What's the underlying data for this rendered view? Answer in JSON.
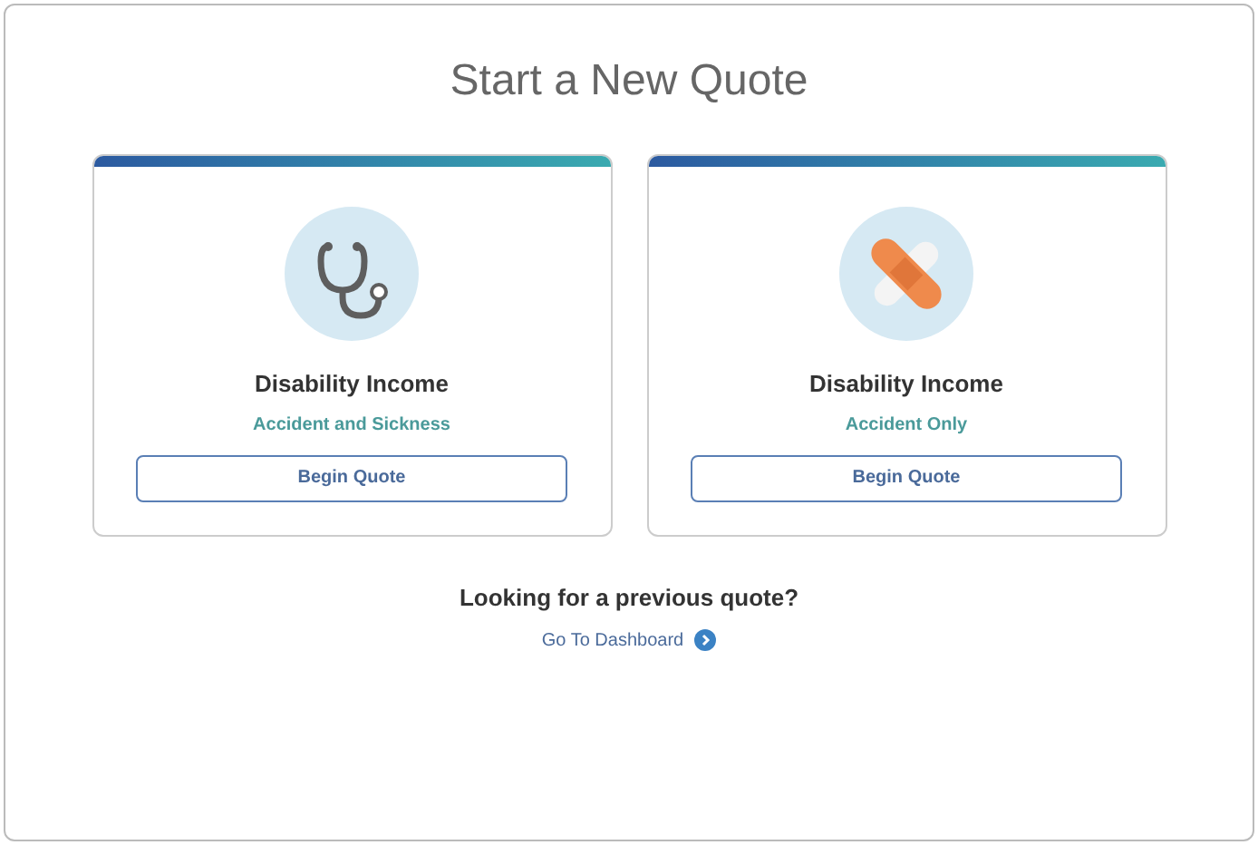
{
  "title": "Start a New Quote",
  "cards": [
    {
      "kind": "stethoscope",
      "title": "Disability Income",
      "subtitle": "Accident and Sickness",
      "button": "Begin Quote"
    },
    {
      "kind": "bandage",
      "title": "Disability Income",
      "subtitle": "Accident Only",
      "button": "Begin Quote"
    }
  ],
  "previous": {
    "question": "Looking for a previous quote?",
    "link": "Go To Dashboard"
  }
}
